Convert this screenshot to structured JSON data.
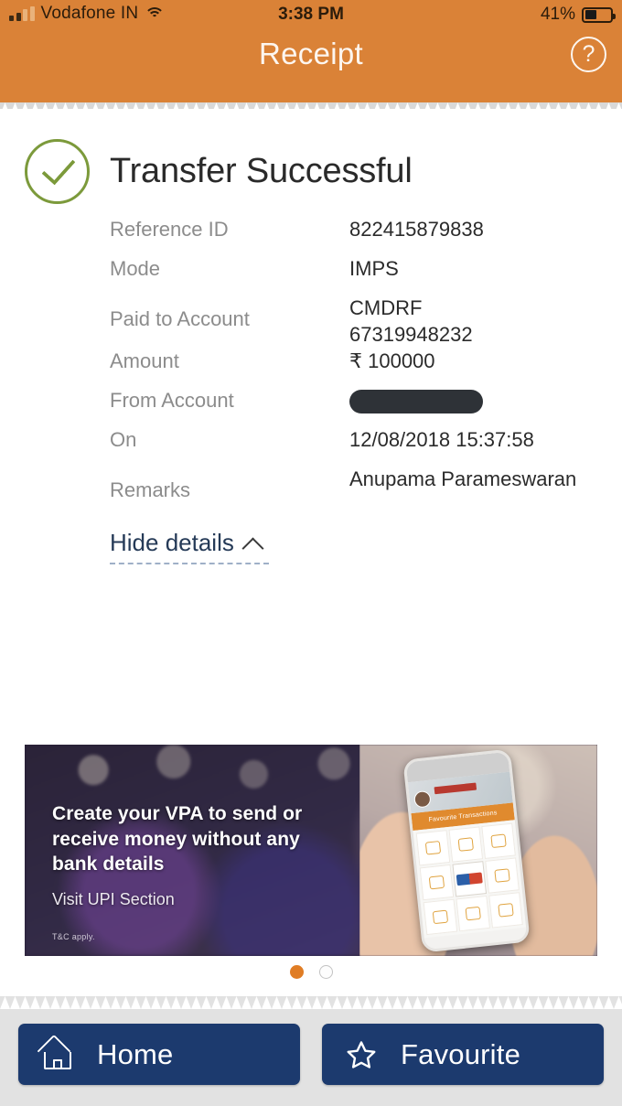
{
  "status_bar": {
    "carrier": "Vodafone IN",
    "signal_icon": "signal-bars-icon",
    "wifi_icon": "wifi-icon",
    "time": "3:38 PM",
    "battery_percent": "41%",
    "battery_icon": "battery-icon"
  },
  "header": {
    "title": "Receipt",
    "help_icon": "help-question-icon",
    "help_label": "?",
    "background_color": "#da8237",
    "title_color": "#fdf6ef"
  },
  "result": {
    "status_text": "Transfer Successful",
    "check_icon": "check-circle-icon",
    "check_color": "#7c9a3b"
  },
  "details": {
    "rows": [
      {
        "label": "Reference ID",
        "value": "822415879838",
        "type": "text"
      },
      {
        "label": "Mode",
        "value": "IMPS",
        "type": "text"
      },
      {
        "label": "Paid to Account",
        "value": "CMDRF\n67319948232",
        "type": "text"
      },
      {
        "label": "Amount",
        "value": "₹ 100000",
        "type": "text"
      },
      {
        "label": "From Account",
        "value": "",
        "type": "redacted"
      },
      {
        "label": "On",
        "value": "12/08/2018 15:37:58",
        "type": "text"
      },
      {
        "label": "Remarks",
        "value": "Anupama Parameswaran",
        "type": "text"
      }
    ],
    "label_color": "#8c8c8c",
    "value_color": "#2b2b2b"
  },
  "toggle": {
    "label": "Hide details",
    "chevron_icon": "chevron-up-icon",
    "color": "#253a57"
  },
  "banner": {
    "headline": "Create your VPA to send or receive money without any bank details",
    "subline": "Visit UPI Section",
    "terms": "T&C apply.",
    "phone_app": {
      "section_label": "Favourite Transactions",
      "upi_tile": "UPI"
    }
  },
  "carousel": {
    "dots": [
      {
        "state": "active",
        "color": "#e07d25"
      },
      {
        "state": "inactive",
        "color": "#fdfdfd"
      }
    ]
  },
  "bottom_nav": {
    "buttons": [
      {
        "label": "Home",
        "icon": "home-icon"
      },
      {
        "label": "Favourite",
        "icon": "star-icon"
      }
    ],
    "button_color": "#1c3a6e",
    "bar_color": "#e2e2e2"
  }
}
